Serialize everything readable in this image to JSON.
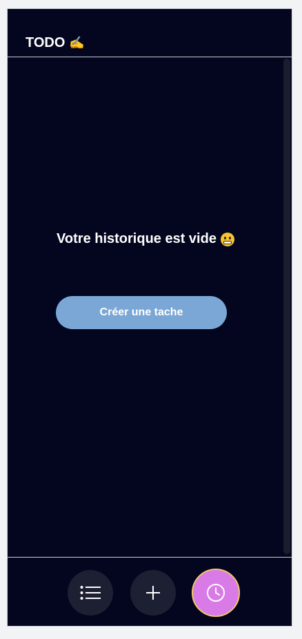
{
  "header": {
    "title": "TODO",
    "title_icon": "writing-hand-icon"
  },
  "main": {
    "empty_message": "Votre historique est vide",
    "empty_icon": "grimacing-face-icon",
    "create_button_label": "Créer une tache"
  },
  "bottom_nav": {
    "items": [
      {
        "icon": "list-icon",
        "active": false
      },
      {
        "icon": "plus-icon",
        "active": false
      },
      {
        "icon": "clock-icon",
        "active": true
      }
    ]
  },
  "colors": {
    "background": "#03061e",
    "button": "#7aa7d6",
    "active_nav": "#d97be6",
    "active_nav_border": "#f1c868",
    "nav_button": "#1d2032"
  }
}
